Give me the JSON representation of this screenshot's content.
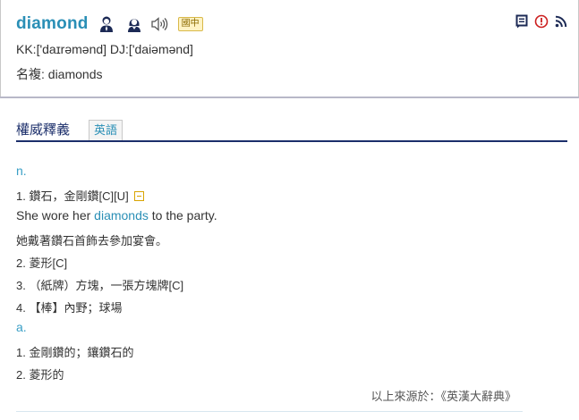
{
  "entry": {
    "word": "diamond",
    "badge": "國中",
    "pronunciation": "KK:['daɪrəmənd] DJ:['daiəmənd]",
    "plural": "名複: diamonds"
  },
  "tabs": {
    "title": "權威釋義",
    "english_tab": "英語"
  },
  "definitions": {
    "noun_pos": "n.",
    "n1": "1. 鑽石，金剛鑽[C][U]",
    "example_before": "She wore her ",
    "example_highlight": "diamonds",
    "example_after": " to the party.",
    "example_zh": "她戴著鑽石首飾去參加宴會。",
    "n2": "2. 菱形[C]",
    "n3": "3. （紙牌）方塊，一張方塊牌[C]",
    "n4": "4. 【棒】內野；球場",
    "adj_pos": "a.",
    "a1": "1. 金剛鑽的；鑲鑽石的",
    "a2": "2. 菱形的"
  },
  "source": "以上來源於：《英漢大辭典》",
  "colors": {
    "word": "#2a8fb6",
    "tab_underline": "#1c2f6b",
    "badge_bg": "#fff3c4"
  },
  "icons": [
    "male-speaker-icon",
    "female-speaker-icon",
    "sound-icon",
    "note-icon",
    "report-icon",
    "rss-icon",
    "collapse-icon"
  ]
}
